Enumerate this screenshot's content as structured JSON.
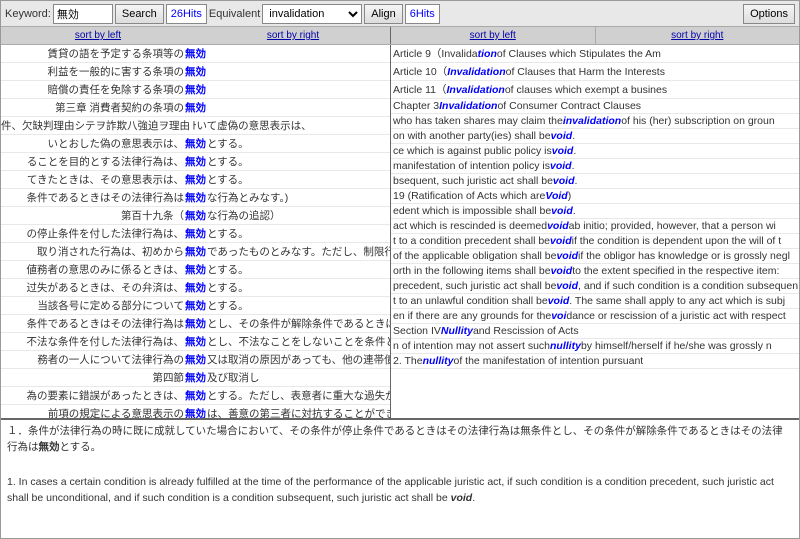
{
  "toolbar": {
    "keyword_label": "Keyword:",
    "keyword_value": "無効",
    "search_btn": "Search",
    "hits_left": "26Hits",
    "equivalent_label": "Equivalent",
    "invalidation_value": "invalidation",
    "align_btn": "Align",
    "hits_right": "6Hits",
    "options_btn": "Options"
  },
  "col_headers": {
    "left": {
      "sort_left": "sort by left",
      "sort_right": "sort by right"
    },
    "right": {
      "sort_left": "sort by left",
      "sort_right": "sort by right"
    }
  },
  "left_lines": [
    {
      "left": "賃貸の語を予定する条項等の",
      "kw": "無効",
      "right": ""
    },
    {
      "left": "利益を一般的に害する条項の",
      "kw": "無効",
      "right": ""
    },
    {
      "left": "賠償の責任を免除する条項の",
      "kw": "無効",
      "right": ""
    },
    {
      "left": "第三章 消費者契約の条項の",
      "kw": "無効",
      "right": ""
    },
    {
      "left": "件、欠缺判理由シテヲ詐欺八強迫ヲ理由トシテトあ",
      "kw": "",
      "right": "いて虚偽の意思表示は、"
    },
    {
      "left": "いとおした偽の意思表示は、",
      "kw": "無効",
      "right": "とする。"
    },
    {
      "left": "ることを目的とする法律行為は、",
      "kw": "無効",
      "right": "とする。"
    },
    {
      "left": "てきたときは、その意思表示は、",
      "kw": "無効",
      "right": "とする。"
    },
    {
      "left": "条件であるときはその法律行為は",
      "kw": "無効",
      "right": "な行為とみなす。)"
    },
    {
      "left": "　　第百十九条（",
      "kw": "無効",
      "right": "な行為の追認）"
    },
    {
      "left": "の停止条件を付した法律行為は、",
      "kw": "無効",
      "right": "とする。"
    },
    {
      "left": "取り消された行為は、初めから",
      "kw": "無効",
      "right": "であったものとみなす。ただし、制限行為能力"
    },
    {
      "left": "値務者の意思のみに係るときは、",
      "kw": "無効",
      "right": "とする。"
    },
    {
      "left": "过失があるときは、その弁済は、",
      "kw": "無効",
      "right": "とする。"
    },
    {
      "left": "当該各号に定める部分について",
      "kw": "無効",
      "right": "とする。"
    },
    {
      "left": "条件であるときはその法律行為は",
      "kw": "無効",
      "right": "とし、その条件が解除条件であるときはその"
    },
    {
      "left": "不法な条件を付した法律行為は、",
      "kw": "無効",
      "right": "とし、不法なことをしないことを条件とする"
    },
    {
      "left": "務者の一人について法律行為の",
      "kw": "無効",
      "right": "又は取消の原因があっても、他の連帯債務"
    },
    {
      "left": "　　　　第四節　",
      "kw": "無効",
      "right": "及び取消し"
    },
    {
      "left": "為の要素に錯誤があったときは、",
      "kw": "無効",
      "right": "とする。ただし、表意者に重大な過失があった"
    },
    {
      "left": "前項の規定による意思表示の",
      "kw": "無効",
      "right": "は、善意の第三者に対抗することができない。"
    }
  ],
  "right_lines": [
    {
      "text": "Article 9（Invalida",
      "kw": "tion",
      "rest": " of Clauses which Stipulates the Am"
    },
    {
      "text": "Article 10（",
      "kw": "Invalidation",
      "rest": " of Clauses that Harm the Interests"
    },
    {
      "text": "Article 11（",
      "kw": "Invalidation",
      "rest": " of clauses which exempt a busines"
    },
    {
      "text": "Chapter 3  ",
      "kw": "Invalidation",
      "rest": " of Consumer Contract Clauses"
    },
    {
      "text": "who has taken shares may claim the ",
      "kw": "invalidation",
      "rest": " of his (her) subscription on groun"
    },
    {
      "text": "on with another party(ies) shall be ",
      "kw": "void",
      "rest": "."
    },
    {
      "text": "ce which is against public policy is ",
      "kw": "void",
      "rest": "."
    },
    {
      "text": "manifestation of intention policy is ",
      "kw": "void",
      "rest": "."
    },
    {
      "text": "bsequent, such juristic act shall be ",
      "kw": "void",
      "rest": "."
    },
    {
      "text": "19 (Ratification of Acts which are ",
      "kw": "Void",
      "rest": ")"
    },
    {
      "text": "edent which is impossible shall be ",
      "kw": "void",
      "rest": "."
    },
    {
      "text": "act which is rescinded is deemed ",
      "kw": "void",
      "rest": " ab initio; provided, however, that a person wi"
    },
    {
      "text": "t to a condition precedent shall be ",
      "kw": "void",
      "rest": " if the condition is dependent upon the will of t"
    },
    {
      "text": "of the applicable obligation shall be ",
      "kw": "void",
      "rest": " if the obligor has knowledge or is grossly negl"
    },
    {
      "text": "orth in the following items shall be ",
      "kw": "void",
      "rest": " to the extent specified in the respective item:"
    },
    {
      "text": "precedent, such juristic act shall be ",
      "kw": "void",
      "rest": ", and if such condition is a condition subsequen"
    },
    {
      "text": "t to an unlawful condition shall be ",
      "kw": "void",
      "rest": ". The same shall apply to any act which is subj"
    },
    {
      "text": "en if there are any grounds for the ",
      "kw": "voi",
      "rest": "dance or rescission of a juristic act with respect"
    },
    {
      "text": "Section IV ",
      "kw": "Nullity",
      "rest": " and Rescission of Acts"
    },
    {
      "text": "n of intention may not assert such ",
      "kw": "nullity",
      "rest": " by himself/herself if he/she was grossly n"
    },
    {
      "text": "2.  The ",
      "kw": "nullity",
      "rest": " of the manifestation of intention pursuant"
    }
  ],
  "bottom_panel": {
    "ja_text": "１．条件が法律行為の時に既に成就していた場合において、その条件が停止条件であるときはその法律行為は無条件とし、その条件が解除条件であるときはその法律行為は無効とする。",
    "en_text_1": "1.  In cases a certain condition is already fulfilled at the time of the performance of the applicable juristic act, if such condition is a condition precedent, such juristic act shall be unconditional, and if such condition is a condition subsequent, such juristic act shall be",
    "en_kw": "void",
    "en_text_2": "."
  }
}
